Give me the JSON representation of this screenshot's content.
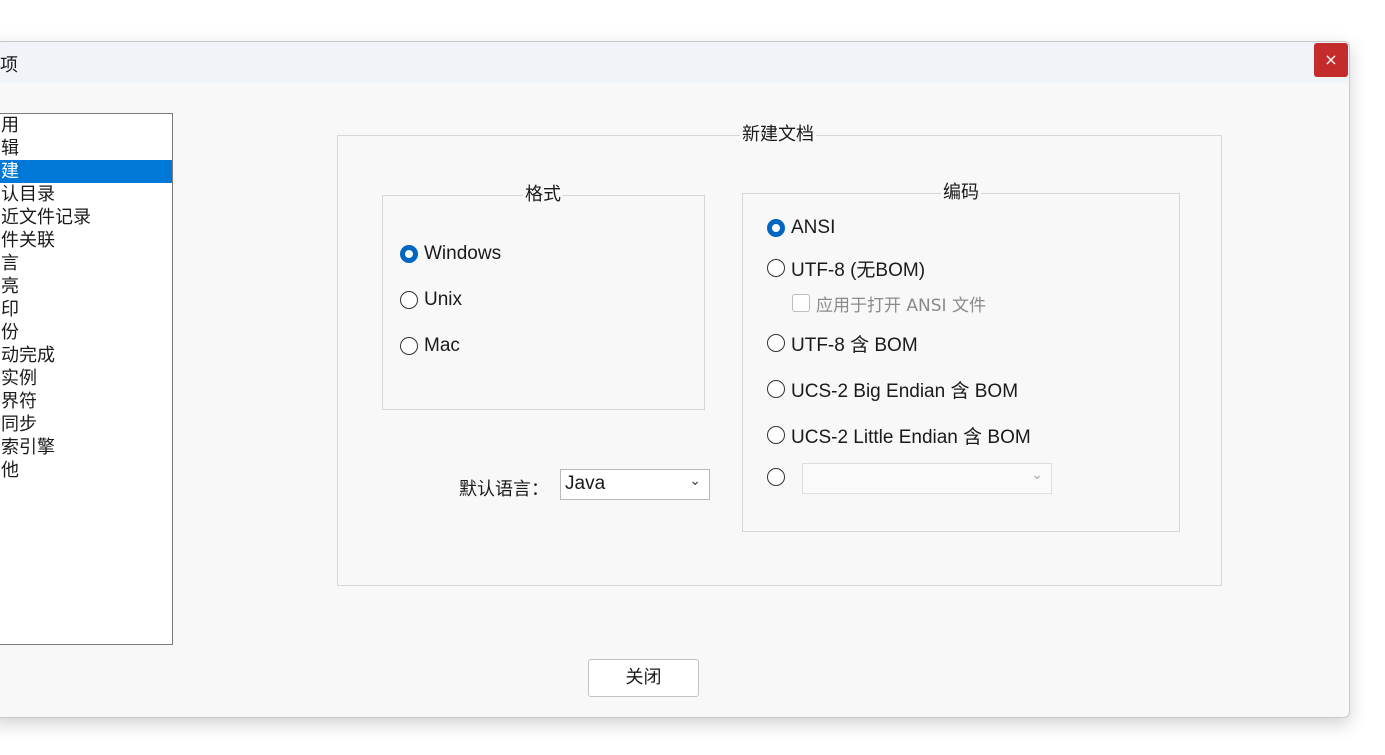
{
  "dialog": {
    "title": "项",
    "close_label": "×",
    "close_button": "关闭"
  },
  "nav": {
    "items": [
      "用",
      "辑",
      "建",
      "认目录",
      "近文件记录",
      "件关联",
      "言",
      "亮",
      "印",
      "份",
      "动完成",
      "实例",
      "界符",
      "同步",
      "索引擎",
      "他"
    ],
    "selected_index": 2
  },
  "new_doc": {
    "group_title": "新建文档",
    "format": {
      "title": "格式",
      "options": [
        "Windows",
        "Unix",
        "Mac"
      ],
      "selected": "Windows"
    },
    "default_lang": {
      "label": "默认语言：",
      "value": "Java"
    },
    "encoding": {
      "title": "编码",
      "ansi": "ANSI",
      "utf8_nobom": "UTF-8 (无BOM)",
      "apply_ansi": "应用于打开 ANSI 文件",
      "utf8_bom": "UTF-8 含 BOM",
      "ucs2_big": "UCS-2 Big Endian 含 BOM",
      "ucs2_little": "UCS-2 Little Endian 含 BOM",
      "other_value": "",
      "selected": "ANSI"
    }
  },
  "icons": {
    "chevron": "chevron-down-icon",
    "close": "close-icon"
  },
  "colors": {
    "accent": "#0067c0",
    "selection": "#0078d7",
    "close_bg": "#c42b2b"
  }
}
